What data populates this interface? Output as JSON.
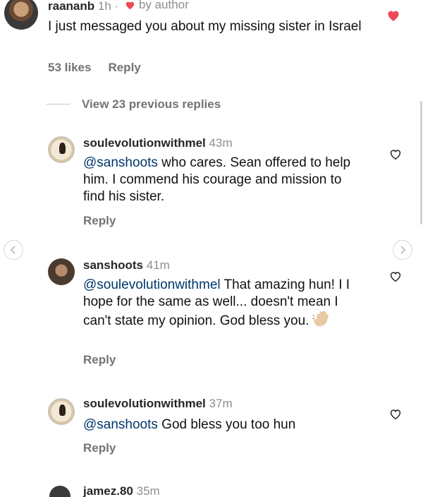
{
  "top_comment": {
    "username": "raananb",
    "time": "1h ·",
    "by_author": "by author",
    "text": "I just messaged you about my missing sister in Israel",
    "likes": "53 likes",
    "reply": "Reply",
    "liked": true
  },
  "view_previous_replies": "View 23 previous replies",
  "replies": [
    {
      "username": "soulevolutionwithmel",
      "time": "43m",
      "mention": "@sanshoots",
      "text": " who cares. Sean offered to help him. I commend his courage and mission to find his sister.",
      "reply": "Reply"
    },
    {
      "username": "sanshoots",
      "time": "41m",
      "mention": "@soulevolutionwithmel",
      "text": " That amazing hun! I I hope for the same as well... doesn't mean I can't state my opinion. God bless you.",
      "emoji": "waving-hand-emoji",
      "reply": "Reply"
    },
    {
      "username": "soulevolutionwithmel",
      "time": "37m",
      "mention": "@sanshoots",
      "text": " God bless you too hun",
      "reply": "Reply"
    },
    {
      "username": "jamez.80",
      "time": "35m"
    }
  ],
  "colors": {
    "like_red": "#ed4956",
    "mention_blue": "#00376b",
    "muted_gray": "#737373"
  }
}
